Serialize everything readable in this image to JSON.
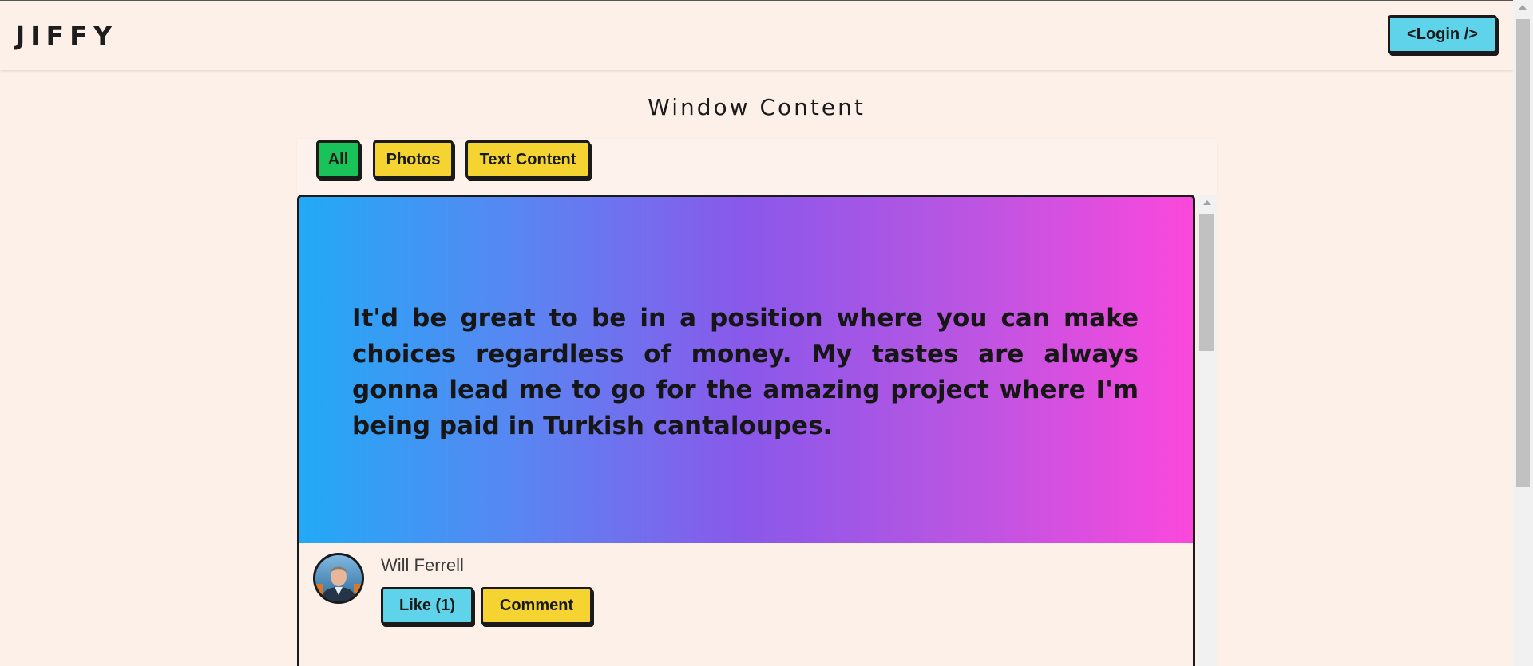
{
  "header": {
    "logo": "JIFFY",
    "login_label": "<Login />"
  },
  "main": {
    "title": "Window Content",
    "filters": [
      {
        "label": "All",
        "active": true,
        "color": "#19c35a"
      },
      {
        "label": "Photos",
        "active": false,
        "color": "#f5d432"
      },
      {
        "label": "Text Content",
        "active": false,
        "color": "#f5d432"
      }
    ]
  },
  "post": {
    "quote": "It'd be great to be in a position where you can make choices regardless of money. My tastes are always gonna lead me to go for the amazing project where I'm being paid in Turkish cantaloupes.",
    "author": "Will Ferrell",
    "like_label": "Like (1)",
    "comment_label": "Comment",
    "gradient_colors": [
      "#22aaf6",
      "#8a58ea",
      "#fb48dc"
    ]
  },
  "colors": {
    "background": "#fdf0e8",
    "accent_cyan": "#5ed3ea",
    "accent_yellow": "#f5d432",
    "accent_green": "#19c35a"
  }
}
